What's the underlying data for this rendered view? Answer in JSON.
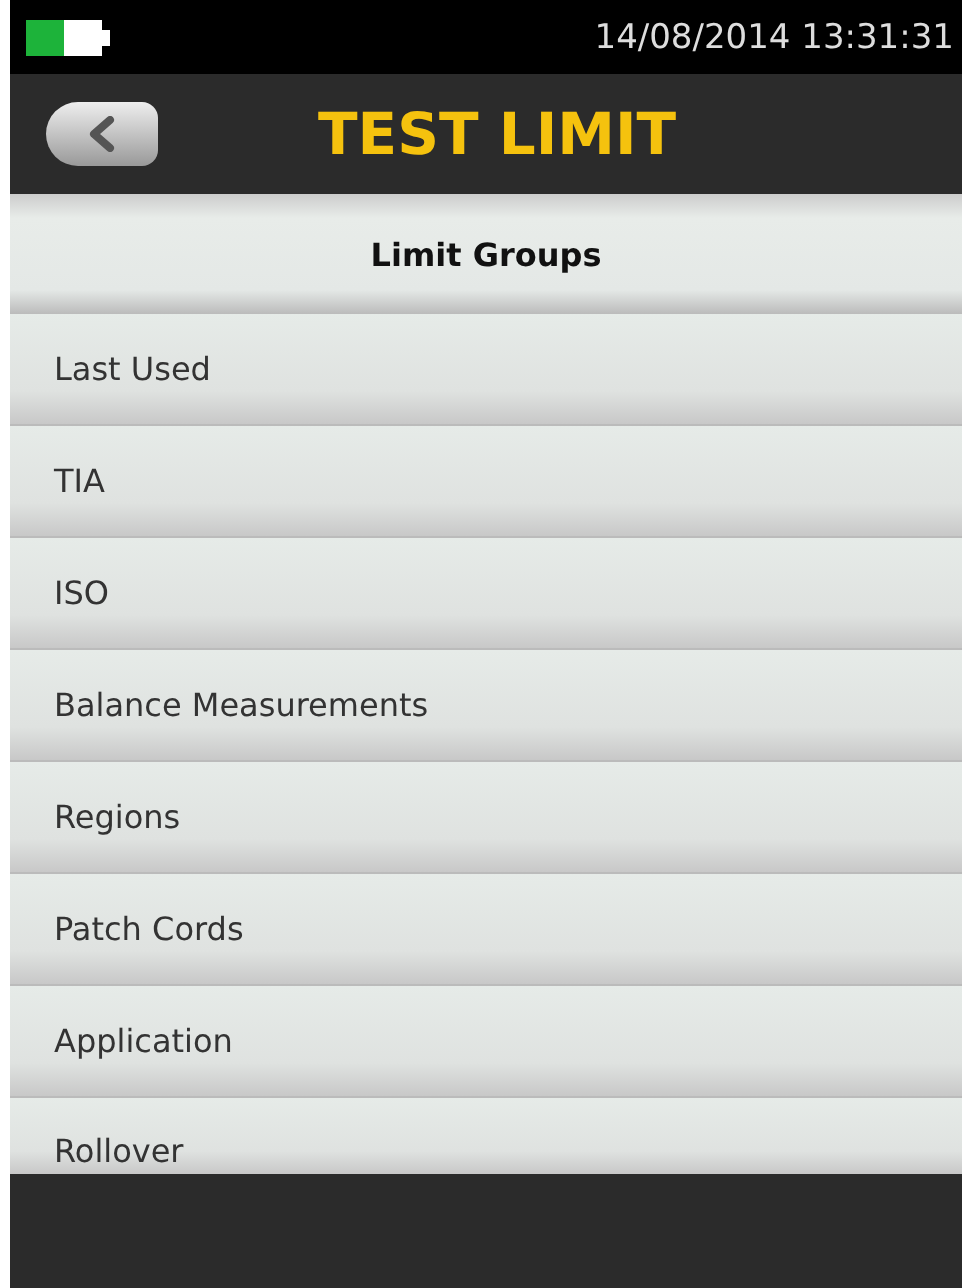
{
  "status_bar": {
    "battery": {
      "level": 0.5
    },
    "datetime": "14/08/2014 13:31:31"
  },
  "header": {
    "title": "TEST LIMIT"
  },
  "section": {
    "title": "Limit Groups"
  },
  "items": [
    {
      "label": "Last Used"
    },
    {
      "label": "TIA"
    },
    {
      "label": "ISO"
    },
    {
      "label": "Balance Measurements"
    },
    {
      "label": "Regions"
    },
    {
      "label": "Patch Cords"
    },
    {
      "label": "Application"
    },
    {
      "label": "Rollover"
    }
  ]
}
